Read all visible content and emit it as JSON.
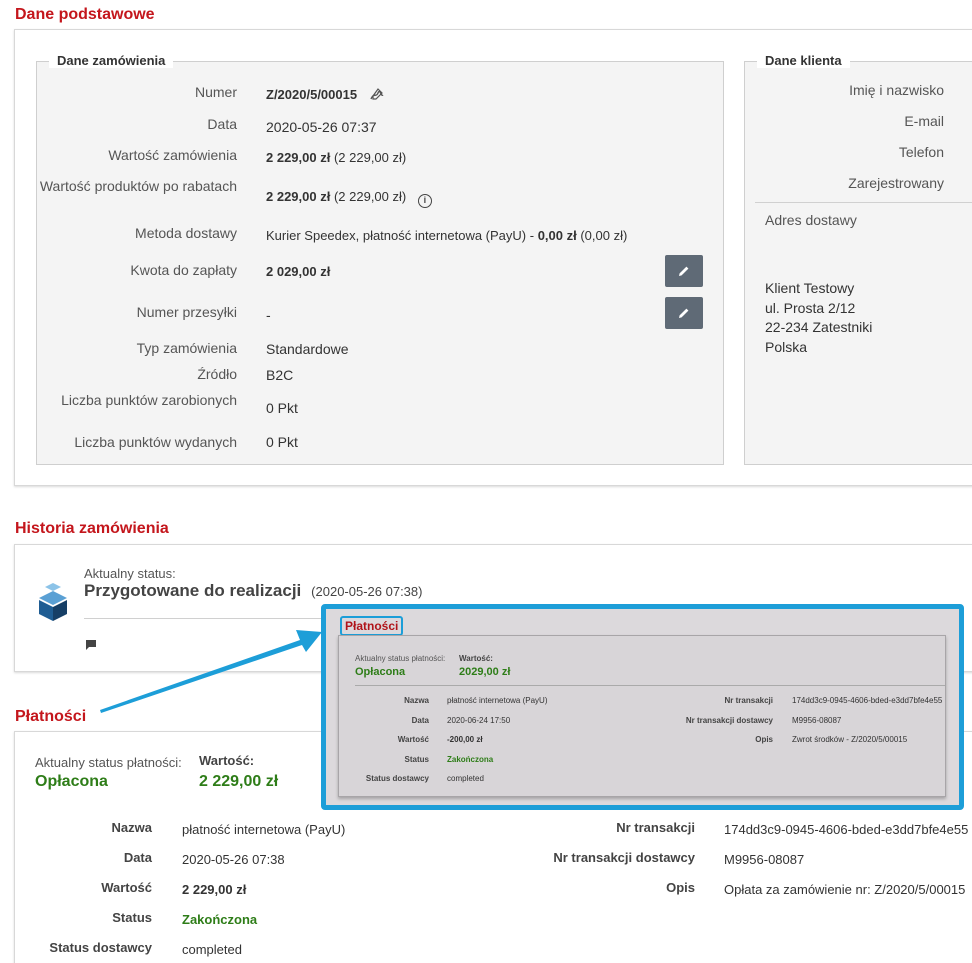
{
  "sections": {
    "basic": "Dane podstawowe",
    "history": "Historia zamówienia",
    "payments": "Płatności"
  },
  "order": {
    "legend": "Dane zamówienia",
    "number_label": "Numer",
    "number_value": "Z/2020/5/00015",
    "date_label": "Data",
    "date_value": "2020-05-26 07:37",
    "order_value_label": "Wartość zamówienia",
    "order_value_bold": "2 229,00 zł",
    "order_value_extra": "(2 229,00 zł)",
    "products_value_label": "Wartość produktów po rabatach",
    "products_value_bold": "2 229,00 zł",
    "products_value_extra": "(2 229,00 zł)",
    "delivery_label": "Metoda dostawy",
    "delivery_text": "Kurier Speedex, płatność internetowa (PayU) - ",
    "delivery_bold": "0,00 zł",
    "delivery_extra": "(0,00 zł)",
    "to_pay_label": "Kwota do zapłaty",
    "to_pay_value": "2 029,00 zł",
    "tracking_label": "Numer przesyłki",
    "tracking_value": "-",
    "type_label": "Typ zamówienia",
    "type_value": "Standardowe",
    "source_label": "Źródło",
    "source_value": "B2C",
    "points_earned_label": "Liczba punktów zarobionych",
    "points_earned_value": "0 Pkt",
    "points_spent_label": "Liczba punktów wydanych",
    "points_spent_value": "0 Pkt"
  },
  "client": {
    "legend": "Dane klienta",
    "name_label": "Imię i nazwisko",
    "email_label": "E-mail",
    "phone_label": "Telefon",
    "registered_label": "Zarejestrowany",
    "address_label": "Adres dostawy",
    "address_lines": [
      "Klient Testowy",
      "ul. Prosta 2/12",
      "22-234 Zatestniki",
      "Polska"
    ]
  },
  "history": {
    "current_status_label": "Aktualny status:",
    "status": "Przygotowane do realizacji",
    "status_date": "(2020-05-26 07:38)"
  },
  "payment": {
    "status_label": "Aktualny status płatności:",
    "status_value": "Opłacona",
    "value_label": "Wartość:",
    "value": "2 229,00 zł",
    "name_label": "Nazwa",
    "name_value": "płatność internetowa (PayU)",
    "date_label": "Data",
    "date_value": "2020-05-26 07:38",
    "amount_label": "Wartość",
    "amount_value": "2 229,00 zł",
    "state_label": "Status",
    "state_value": "Zakończona",
    "delivery_status_label": "Status dostawcy",
    "delivery_status_value": "completed",
    "tx_label": "Nr transakcji",
    "tx_value": "174dd3c9-0945-4606-bded-e3dd7bfe4e55",
    "tx_provider_label": "Nr transakcji dostawcy",
    "tx_provider_value": "M9956-08087",
    "desc_label": "Opis",
    "desc_value": "Opłata za zamówienie nr: Z/2020/5/00015"
  },
  "refund_popup": {
    "title": "Płatności",
    "status_label": "Aktualny status płatności:",
    "status_value": "Opłacona",
    "value_label": "Wartość:",
    "value": "2029,00 zł",
    "name_label": "Nazwa",
    "name_value": "płatność internetowa (PayU)",
    "date_label": "Data",
    "date_value": "2020-06-24 17:50",
    "amount_label": "Wartość",
    "amount_value": "-200,00 zł",
    "state_label": "Status",
    "state_value": "Zakończona",
    "delivery_status_label": "Status dostawcy",
    "delivery_status_value": "completed",
    "tx_label": "Nr transakcji",
    "tx_value": "174dd3c9-0945-4606-bded-e3dd7bfe4e55",
    "tx_provider_label": "Nr transakcji dostawcy",
    "tx_provider_value": "M9956-08087",
    "desc_label": "Opis",
    "desc_value": "Zwrot środków - Z/2020/5/00015"
  },
  "colors": {
    "accent_red": "#c4161c",
    "status_green": "#2e7d18",
    "callout_blue": "#1d9ed8",
    "button_gray": "#5f6a76"
  }
}
